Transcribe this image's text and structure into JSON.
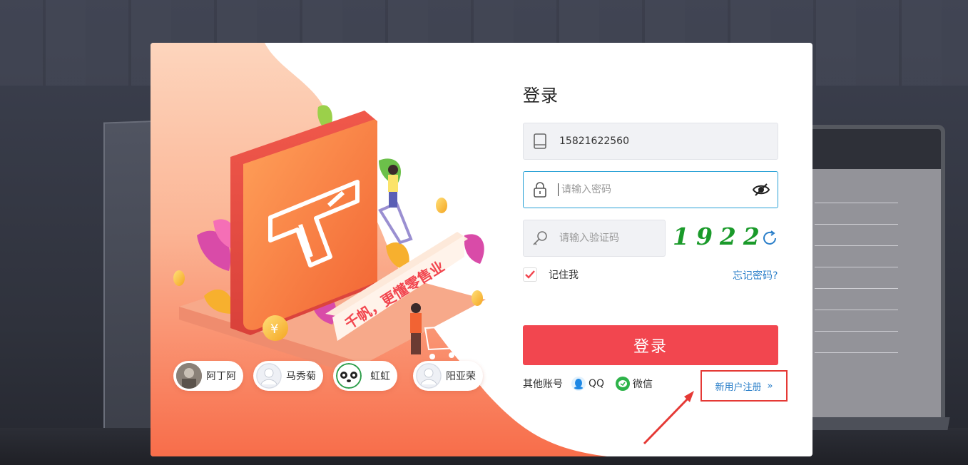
{
  "login": {
    "title": "登录",
    "phone": {
      "value": "15821622560",
      "icon": "phone-icon"
    },
    "password": {
      "placeholder": "请输入密码",
      "icon": "lock-icon",
      "toggle_icon": "eye-off-icon"
    },
    "captcha": {
      "placeholder": "请输入验证码",
      "icon": "key-icon",
      "code": "1922",
      "refresh_icon": "refresh-icon"
    },
    "remember_label": "记住我",
    "remember_checked": true,
    "forgot_label": "忘记密码?",
    "submit_label": "登录",
    "other_accounts_label": "其他账号",
    "qq_label": "QQ",
    "wechat_label": "微信",
    "register_label": "新用户注册",
    "register_chevron": "»"
  },
  "illustration": {
    "slogan": "千帆，更懂零售业"
  },
  "recent_accounts": [
    {
      "name": "阿丁阿"
    },
    {
      "name": "马秀菊"
    },
    {
      "name": "虹虹"
    },
    {
      "name": "阳亚荣"
    }
  ],
  "colors": {
    "primary_button": "#f2464f",
    "link": "#2b7fc9",
    "focus_border": "#29a1d6",
    "captcha_text": "#1a9a2a",
    "highlight_box": "#e53935"
  }
}
